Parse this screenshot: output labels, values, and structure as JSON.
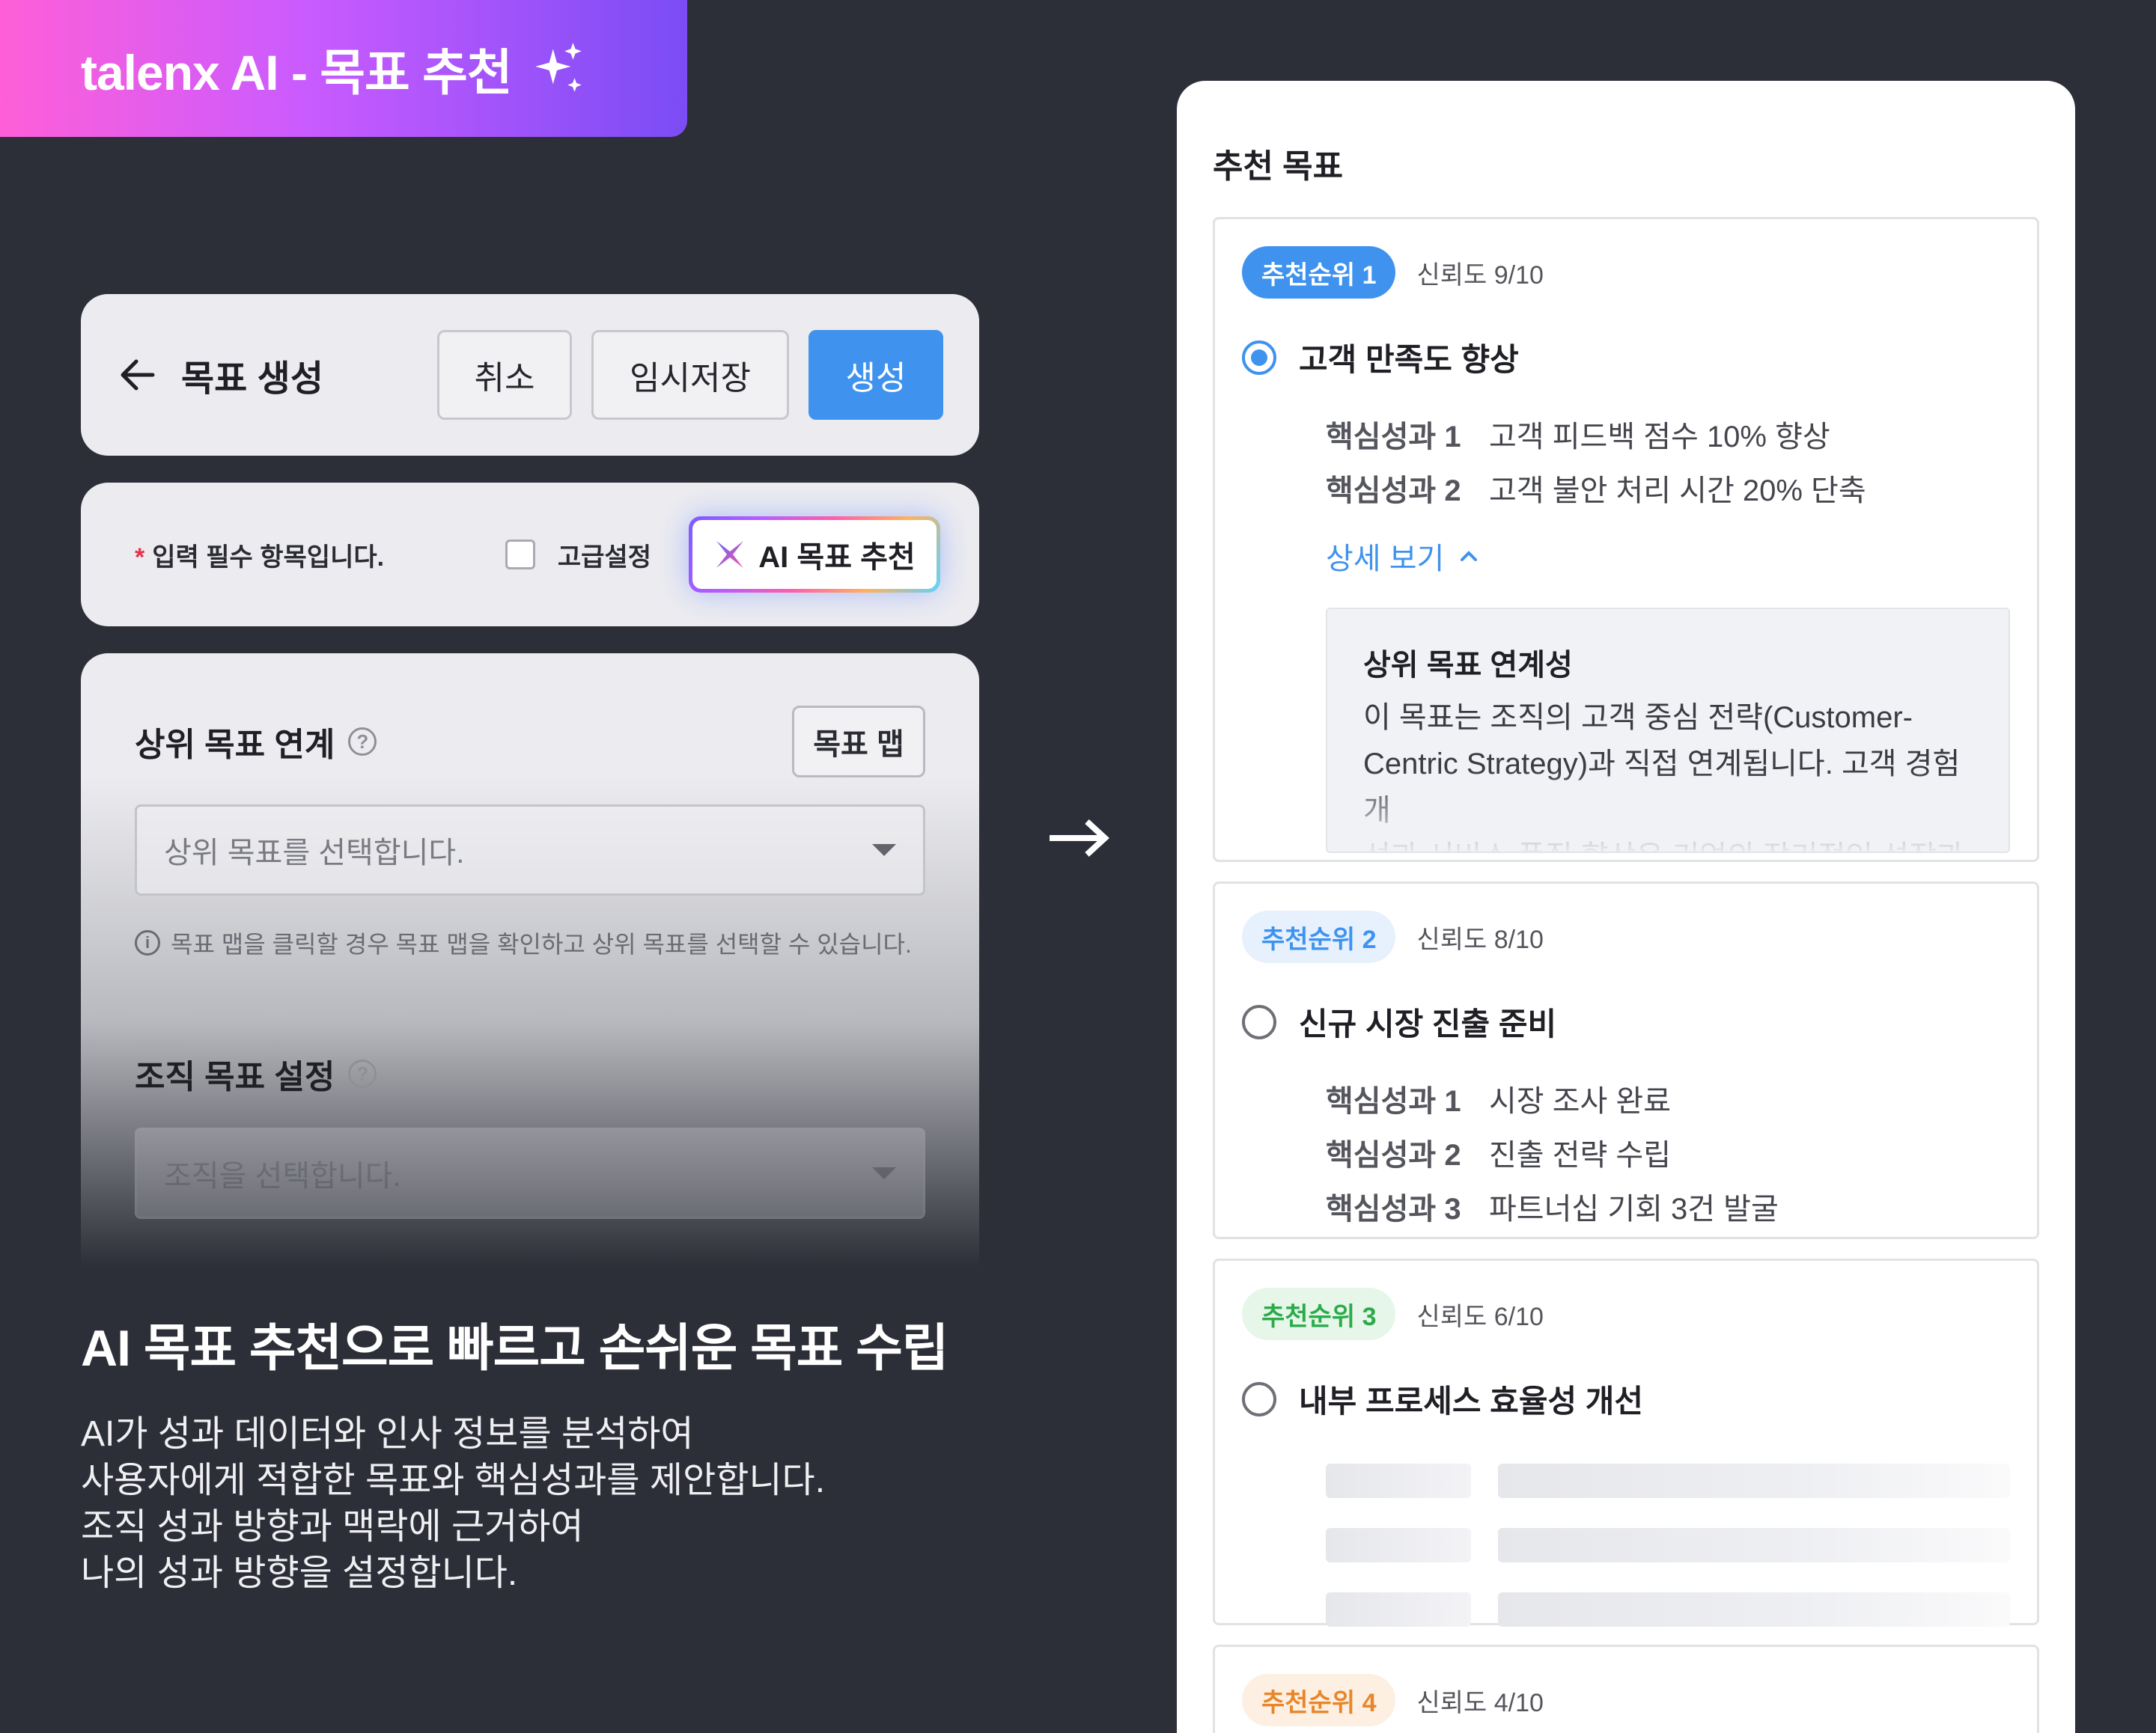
{
  "banner": {
    "title": "talenx AI - 목표 추천",
    "icon": "sparkle-icon"
  },
  "header": {
    "title": "목표 생성",
    "cancel_label": "취소",
    "temp_save_label": "임시저장",
    "create_label": "생성",
    "accent": "#3f93ee"
  },
  "options": {
    "required_star": "*",
    "required_text": "입력 필수 항목입니다.",
    "advanced_label": "고급설정",
    "ai_button_label": "AI 목표 추천"
  },
  "form": {
    "parent_label": "상위 목표 연계",
    "help_mark": "?",
    "map_button": "목표 맵",
    "parent_placeholder": "상위 목표를 선택합니다.",
    "info_mark": "i",
    "info_text": "목표 맵을 클릭할 경우 목표 맵을 확인하고 상위 목표를 선택할 수 있습니다.",
    "org_label": "조직 목표 설정",
    "org_placeholder": "조직을 선택합니다."
  },
  "marketing": {
    "headline": "AI 목표 추천으로 빠르고 손쉬운 목표 수립",
    "desc_lines": [
      "AI가 성과 데이터와 인사 정보를 분석하여",
      "사용자에게 적합한 목표와 핵심성과를 제안합니다.",
      "조직 성과 방향과 맥락에 근거하여",
      "나의 성과 방향을 설정합니다."
    ]
  },
  "recommendations": {
    "title": "추천 목표",
    "cards": [
      {
        "rank": "추천순위 1",
        "reliability": "신뢰도 9/10",
        "goal": "고객 만족도 향상",
        "selected": true,
        "key_results": [
          {
            "label": "핵심성과 1",
            "value": "고객 피드백 점수 10% 향상"
          },
          {
            "label": "핵심성과 2",
            "value": "고객 불안 처리 시간 20% 단축"
          }
        ],
        "detail_link": "상세 보기",
        "detail_title": "상위 목표 연계성",
        "detail_lines": [
          "이 목표는 조직의 고객 중심 전략(Customer-",
          "Centric Strategy)과 직접 연계됩니다. 고객 경험 개",
          "선과 서비스 품질 향상은 기업의 장기적인 성장과 브"
        ]
      },
      {
        "rank": "추천순위 2",
        "reliability": "신뢰도 8/10",
        "goal": "신규 시장 진출 준비",
        "selected": false,
        "key_results": [
          {
            "label": "핵심성과 1",
            "value": "시장 조사 완료"
          },
          {
            "label": "핵심성과 2",
            "value": "진출 전략 수립"
          },
          {
            "label": "핵심성과 3",
            "value": "파트너십 기회 3건 발굴"
          }
        ]
      },
      {
        "rank": "추천순위 3",
        "reliability": "신뢰도 6/10",
        "goal": "내부 프로세스 효율성 개선",
        "selected": false,
        "loading": true
      },
      {
        "rank": "추천순위 4",
        "reliability": "신뢰도 4/10"
      }
    ]
  }
}
